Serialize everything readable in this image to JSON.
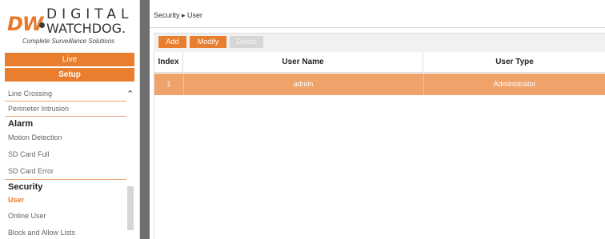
{
  "logo": {
    "brand_short": "DW",
    "brand_line1": "DIGITAL",
    "brand_line2": "WATCHDOG.",
    "tagline": "Complete Surveillance Solutions"
  },
  "nav": {
    "live": "Live",
    "setup": "Setup"
  },
  "menu": {
    "line_crossing": "Line Crossing",
    "perimeter_intrusion": "Perimeter Intrusion",
    "alarm_header": "Alarm",
    "motion_detection": "Motion Detection",
    "sd_card_full": "SD Card Full",
    "sd_card_error": "SD Card Error",
    "security_header": "Security",
    "user": "User",
    "online_user": "Online User",
    "block_allow": "Block and Allow Lists"
  },
  "breadcrumb": "Security ▸ User",
  "toolbar": {
    "add": "Add",
    "modify": "Modify",
    "delete": "Delete"
  },
  "table": {
    "headers": [
      "Index",
      "User Name",
      "User Type"
    ],
    "rows": [
      {
        "index": "1",
        "username": "admin",
        "usertype": "Administrator"
      }
    ]
  },
  "colors": {
    "accent": "#e97e2f",
    "selected_row": "#f0a26b",
    "gutter": "#6f6f6f"
  }
}
